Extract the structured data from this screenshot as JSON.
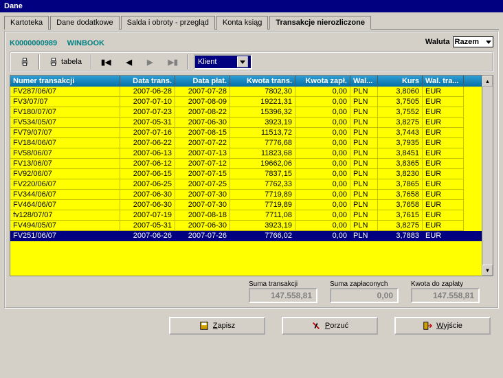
{
  "window_title": "Dane",
  "tabs": [
    "Kartoteka",
    "Dane dodatkowe",
    "Salda i obroty - przegląd",
    "Konta ksiąg",
    "Transakcje nierozliczone"
  ],
  "active_tab": 4,
  "account": {
    "code": "K0000000989",
    "name": "WINBOOK"
  },
  "waluta": {
    "label": "Waluta",
    "value": "Razem"
  },
  "toolbar": {
    "tabela": "tabela",
    "dropdown_value": "Klient"
  },
  "columns": [
    "Numer transakcji",
    "Data trans.",
    "Data płat.",
    "Kwota trans.",
    "Kwota zapł.",
    "Wal...",
    "Kurs",
    "Wal. tra..."
  ],
  "rows": [
    {
      "num": "FV287/06/07",
      "dt": "2007-06-28",
      "dp": "2007-07-28",
      "kt": "7802,30",
      "kz": "0,00",
      "w1": "PLN",
      "kurs": "3,8060",
      "w2": "EUR"
    },
    {
      "num": "FV3/07/07",
      "dt": "2007-07-10",
      "dp": "2007-08-09",
      "kt": "19221,31",
      "kz": "0,00",
      "w1": "PLN",
      "kurs": "3,7505",
      "w2": "EUR"
    },
    {
      "num": "FV180/07/07",
      "dt": "2007-07-23",
      "dp": "2007-08-22",
      "kt": "15396,32",
      "kz": "0,00",
      "w1": "PLN",
      "kurs": "3,7552",
      "w2": "EUR"
    },
    {
      "num": "FV534/05/07",
      "dt": "2007-05-31",
      "dp": "2007-06-30",
      "kt": "3923,19",
      "kz": "0,00",
      "w1": "PLN",
      "kurs": "3,8275",
      "w2": "EUR"
    },
    {
      "num": "FV79/07/07",
      "dt": "2007-07-16",
      "dp": "2007-08-15",
      "kt": "11513,72",
      "kz": "0,00",
      "w1": "PLN",
      "kurs": "3,7443",
      "w2": "EUR"
    },
    {
      "num": "FV184/06/07",
      "dt": "2007-06-22",
      "dp": "2007-07-22",
      "kt": "7776,68",
      "kz": "0,00",
      "w1": "PLN",
      "kurs": "3,7935",
      "w2": "EUR"
    },
    {
      "num": "FV58/06/07",
      "dt": "2007-06-13",
      "dp": "2007-07-13",
      "kt": "11823,68",
      "kz": "0,00",
      "w1": "PLN",
      "kurs": "3,8451",
      "w2": "EUR"
    },
    {
      "num": "FV13/06/07",
      "dt": "2007-06-12",
      "dp": "2007-07-12",
      "kt": "19662,06",
      "kz": "0,00",
      "w1": "PLN",
      "kurs": "3,8365",
      "w2": "EUR"
    },
    {
      "num": "FV92/06/07",
      "dt": "2007-06-15",
      "dp": "2007-07-15",
      "kt": "7837,15",
      "kz": "0,00",
      "w1": "PLN",
      "kurs": "3,8230",
      "w2": "EUR"
    },
    {
      "num": "FV220/06/07",
      "dt": "2007-06-25",
      "dp": "2007-07-25",
      "kt": "7762,33",
      "kz": "0,00",
      "w1": "PLN",
      "kurs": "3,7865",
      "w2": "EUR"
    },
    {
      "num": "FV344/06/07",
      "dt": "2007-06-30",
      "dp": "2007-07-30",
      "kt": "7719,89",
      "kz": "0,00",
      "w1": "PLN",
      "kurs": "3,7658",
      "w2": "EUR"
    },
    {
      "num": "FV464/06/07",
      "dt": "2007-06-30",
      "dp": "2007-07-30",
      "kt": "7719,89",
      "kz": "0,00",
      "w1": "PLN",
      "kurs": "3,7658",
      "w2": "EUR"
    },
    {
      "num": "fv128/07/07",
      "dt": "2007-07-19",
      "dp": "2007-08-18",
      "kt": "7711,08",
      "kz": "0,00",
      "w1": "PLN",
      "kurs": "3,7615",
      "w2": "EUR"
    },
    {
      "num": "FV494/05/07",
      "dt": "2007-05-31",
      "dp": "2007-06-30",
      "kt": "3923,19",
      "kz": "0,00",
      "w1": "PLN",
      "kurs": "3,8275",
      "w2": "EUR"
    },
    {
      "num": "FV251/06/07",
      "dt": "2007-06-26",
      "dp": "2007-07-26",
      "kt": "7766,02",
      "kz": "0,00",
      "w1": "PLN",
      "kurs": "3,7883",
      "w2": "EUR",
      "selected": true
    }
  ],
  "summary": {
    "suma_trans_label": "Suma transakcji",
    "suma_trans_value": "147.558,81",
    "suma_zapl_label": "Suma zapłaconych",
    "suma_zapl_value": "0,00",
    "kwota_label": "Kwota do zapłaty",
    "kwota_value": "147.558,81"
  },
  "buttons": {
    "zapisz": "Zapisz",
    "porzuc": "Porzuć",
    "wyjscie": "Wyjście"
  }
}
